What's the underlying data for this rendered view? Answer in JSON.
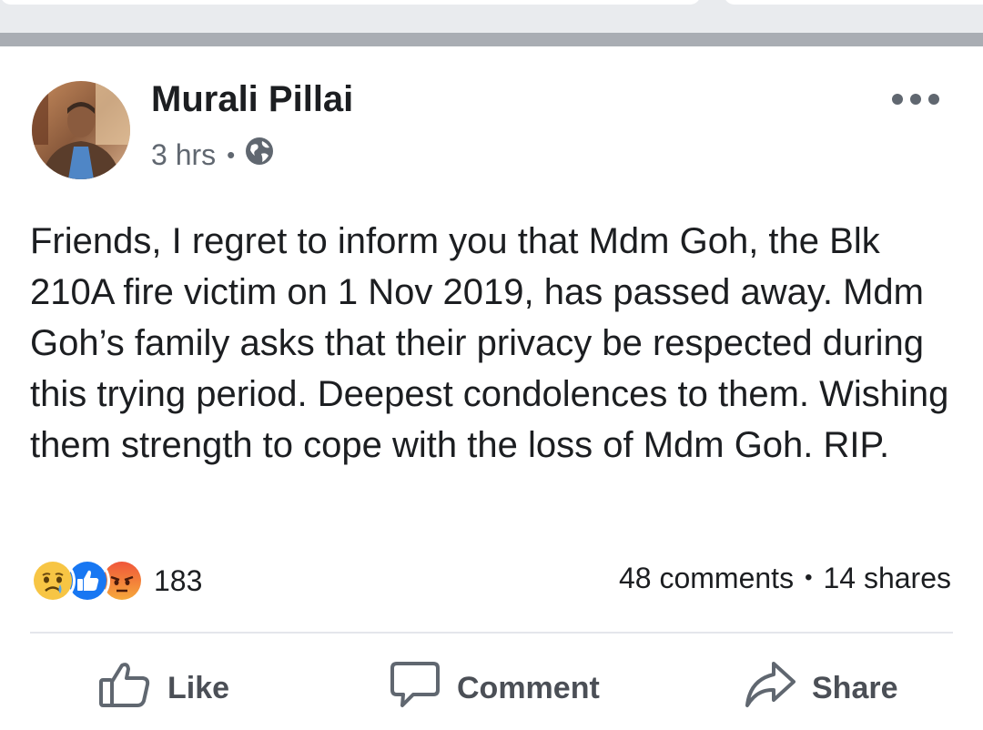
{
  "post": {
    "author": "Murali Pillai",
    "time": "3 hrs",
    "visibility_icon": "globe-icon",
    "text": "Friends, I regret to inform you that Mdm Goh, the Blk 210A fire victim on 1 Nov 2019, has passed away. Mdm Goh’s family asks that their privacy be respected during this trying period. Deepest condolences to them. Wishing them strength to cope with the loss of Mdm Goh. RIP.",
    "reactions": [
      "sad-emoji-icon",
      "like-icon",
      "angry-emoji-icon"
    ],
    "reaction_count": "183",
    "comments": "48 comments",
    "shares": "14 shares"
  },
  "actions": {
    "like": "Like",
    "comment": "Comment",
    "share": "Share"
  },
  "colors": {
    "text": "#1c1e21",
    "secondary": "#606770",
    "action": "#4b4f56",
    "divider": "#a9adb3",
    "like_blue": "#1877f2"
  }
}
